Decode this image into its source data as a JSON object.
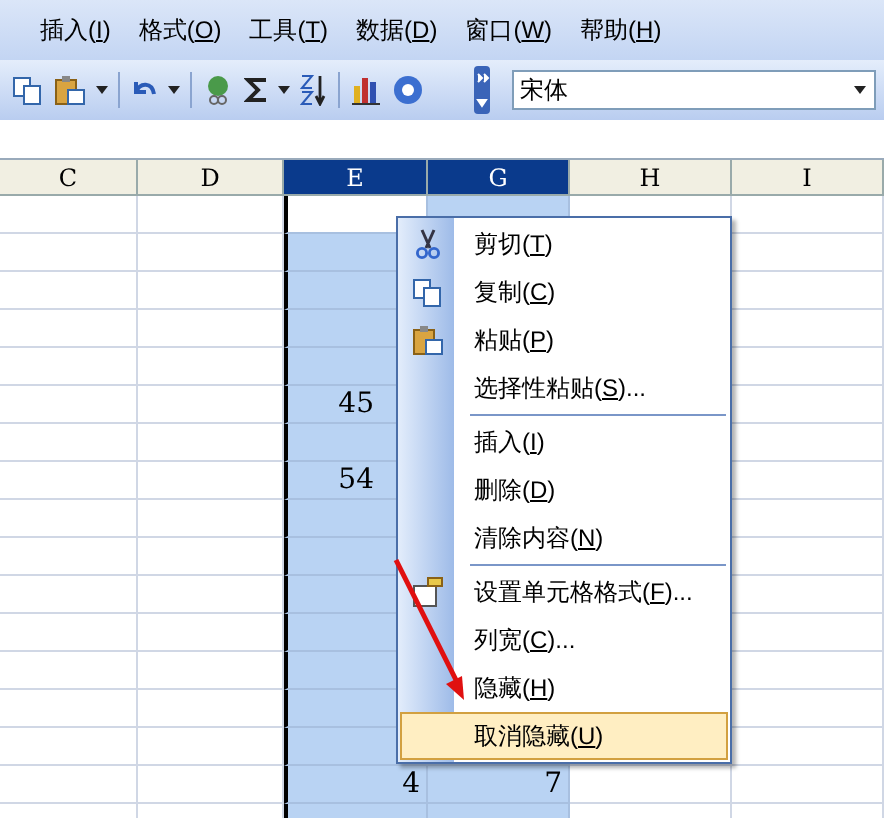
{
  "menu_bar": [
    {
      "label": "插入(",
      "hotkey": "I",
      "after": ")"
    },
    {
      "label": "格式(",
      "hotkey": "O",
      "after": ")"
    },
    {
      "label": "工具(",
      "hotkey": "T",
      "after": ")"
    },
    {
      "label": "数据(",
      "hotkey": "D",
      "after": ")"
    },
    {
      "label": "窗口(",
      "hotkey": "W",
      "after": ")"
    },
    {
      "label": "帮助(",
      "hotkey": "H",
      "after": ")"
    }
  ],
  "toolbar": {
    "font": "宋体"
  },
  "columns": [
    {
      "label": "C",
      "selected": false
    },
    {
      "label": "D",
      "selected": false
    },
    {
      "label": "E",
      "selected": true
    },
    {
      "label": "G",
      "selected": true
    },
    {
      "label": "H",
      "selected": false
    },
    {
      "label": "I",
      "selected": false
    }
  ],
  "rows": [
    {},
    {},
    {},
    {},
    {},
    {
      "column_3": "45"
    },
    {},
    {
      "column_3": "54"
    },
    {},
    {},
    {},
    {},
    {},
    {},
    {},
    {
      "column_3": "4",
      "column_4": "7"
    }
  ],
  "context_menu": [
    {
      "kind": "item",
      "label": "剪切(",
      "hotkey": "T",
      "after": ")",
      "selected": false
    },
    {
      "kind": "item",
      "label": "复制(",
      "hotkey": "C",
      "after": ")",
      "selected": false
    },
    {
      "kind": "item",
      "label": "粘贴(",
      "hotkey": "P",
      "after": ")",
      "selected": false
    },
    {
      "kind": "item",
      "label": "选择性粘贴(",
      "hotkey": "S",
      "after": ")...",
      "selected": false
    },
    {
      "kind": "separator"
    },
    {
      "kind": "item",
      "label": "插入(",
      "hotkey": "I",
      "after": ")",
      "selected": false
    },
    {
      "kind": "item",
      "label": "删除(",
      "hotkey": "D",
      "after": ")",
      "selected": false
    },
    {
      "kind": "item",
      "label": "清除内容(",
      "hotkey": "N",
      "after": ")",
      "selected": false
    },
    {
      "kind": "separator"
    },
    {
      "kind": "item",
      "label": "设置单元格格式(",
      "hotkey": "F",
      "after": ")...",
      "selected": false
    },
    {
      "kind": "item",
      "label": "列宽(",
      "hotkey": "C",
      "after": ")...",
      "selected": false
    },
    {
      "kind": "item",
      "label": "隐藏(",
      "hotkey": "H",
      "after": ")",
      "selected": false
    },
    {
      "kind": "item",
      "label": "取消隐藏(",
      "hotkey": "U",
      "after": ")",
      "selected": true
    }
  ]
}
